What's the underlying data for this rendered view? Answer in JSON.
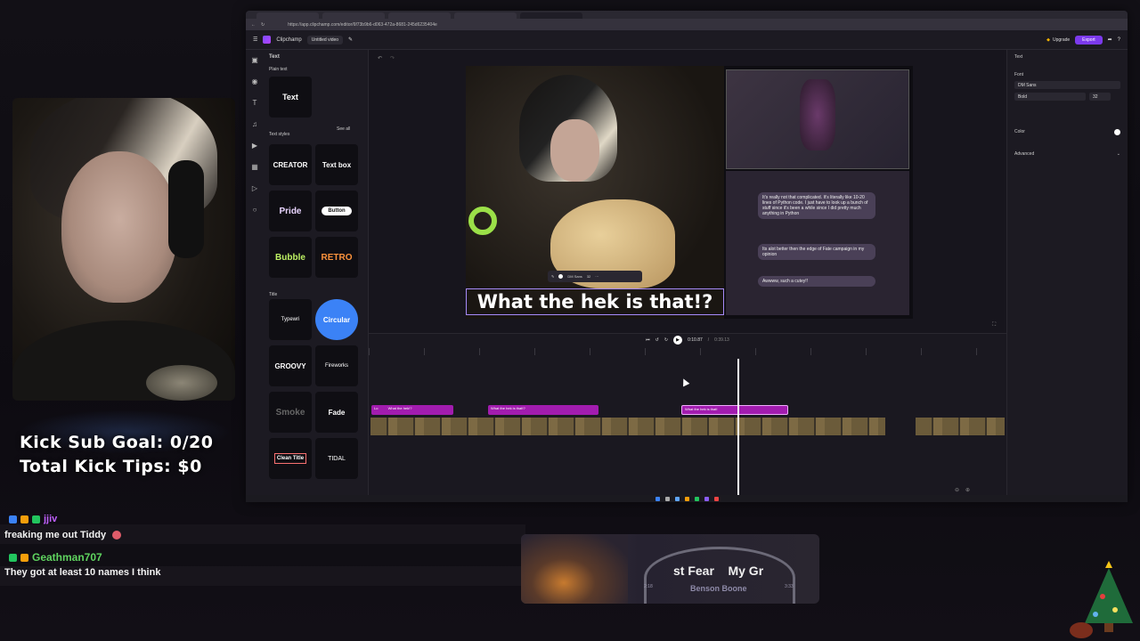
{
  "stream": {
    "kick_sub_goal": "Kick Sub Goal: 0/20",
    "total_kick_tips": "Total Kick Tips: $0"
  },
  "chat": [
    {
      "user": "jjiv",
      "message": "freaking me out Tiddy",
      "user_color": "#c060ff"
    },
    {
      "user": "Geathman707",
      "message": "They got at least 10 names I think",
      "user_color": "#5fd35f"
    }
  ],
  "browser": {
    "url": "https://app.clipchamp.com/editor/6f73b9b6-d063-472a-8681-245d6235404e"
  },
  "clipchamp": {
    "app_name": "Clipchamp",
    "project_name": "Untitled video",
    "upgrade_label": "Upgrade",
    "export_label": "Export",
    "panel_title": "Text",
    "plain_text_heading": "Plain text",
    "plain_text_card": "Text",
    "text_styles_heading": "Text styles",
    "see_all": "See all",
    "styles": [
      "CREATOR",
      "Text box",
      "Pride",
      "Button",
      "Bubble",
      "RETRO"
    ],
    "title_heading": "Title",
    "titles": [
      "Typewri",
      "Circular",
      "GROOVY",
      "Fireworks",
      "Smoke",
      "Fade",
      "Clean Title",
      "TIDAL"
    ],
    "caption_text": "What the hek is that!?",
    "caption_font": "DM Sans",
    "caption_size": "32",
    "props_title": "Text",
    "props_font_label": "Font",
    "props_font": "DM Sans",
    "props_weight": "Bold",
    "props_size": "32",
    "props_color_label": "Color",
    "props_advanced_label": "Advanced",
    "time_current": "0:10.87",
    "time_total": "0:39.13",
    "clips": [
      "What the hek!?",
      "What the hek is that!?",
      "What the hek is that!"
    ],
    "clip0": "Lo"
  },
  "game_chat": [
    "It's really not that complicated. It's literally like 10-20 lines of Python code. I just have to look up a bunch of stuff since it's been a while since I did pretty much anything in Python",
    "Its alot better then the edge of Fate campaign in my opinion",
    "Awwww, such a cutey!!"
  ],
  "music": {
    "song": "st Fear    My Gr",
    "artist": "Benson Boone",
    "elapsed": "2:18",
    "duration": "3:33"
  },
  "colors": {
    "accent": "#7c3aed",
    "clip": "#a21caf"
  }
}
